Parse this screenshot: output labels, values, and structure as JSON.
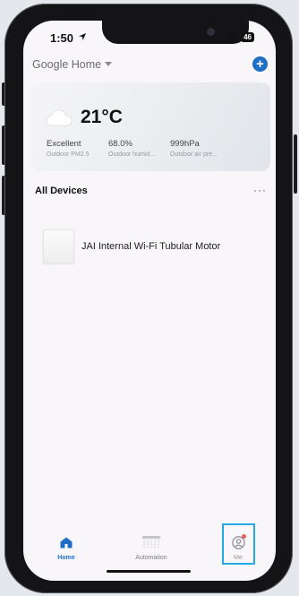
{
  "status_bar": {
    "time": "1:50",
    "battery": "46"
  },
  "header": {
    "home_name": "Google Home",
    "add_button": "+"
  },
  "weather": {
    "temperature": "21°C",
    "metrics": [
      {
        "value": "Excellent",
        "label": "Outdoor PM2.5"
      },
      {
        "value": "68.0%",
        "label": "Outdoor humid..."
      },
      {
        "value": "999hPa",
        "label": "Outdoor air pre..."
      }
    ]
  },
  "devices_section": {
    "title": "All Devices",
    "more": "···"
  },
  "devices": [
    {
      "name": "JAI Internal Wi-Fi Tubular Motor"
    }
  ],
  "tabbar": {
    "tabs": [
      {
        "label": "Home",
        "icon": "home-icon",
        "active": true
      },
      {
        "label": "Automation",
        "icon": "automation-icon",
        "active": false
      },
      {
        "label": "Me",
        "icon": "user-icon",
        "active": false
      }
    ]
  },
  "colors": {
    "accent": "#1f6fc6",
    "highlight": "#25a8e8",
    "badge": "#e23b3b"
  }
}
